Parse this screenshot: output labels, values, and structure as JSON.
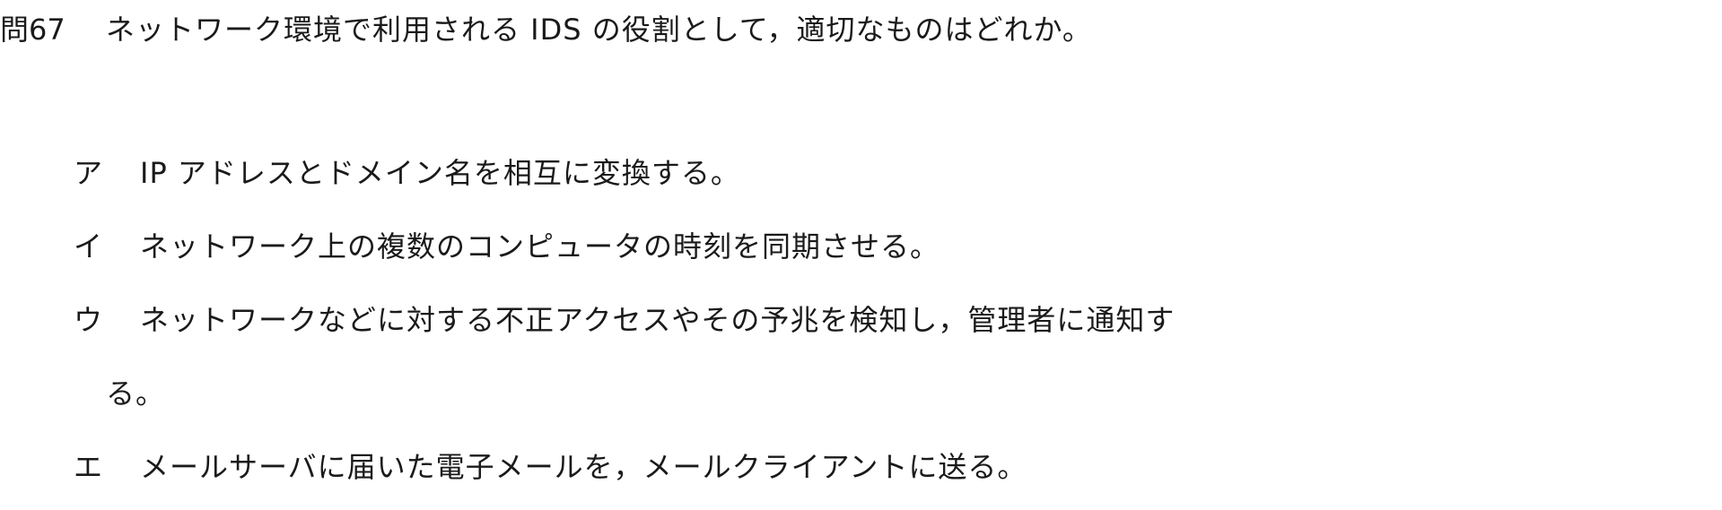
{
  "question": {
    "number": "問67",
    "text": "ネットワーク環境で利用される IDS の役割として，適切なものはどれか。"
  },
  "choices": [
    {
      "label": "ア",
      "text": "IP アドレスとドメイン名を相互に変換する。"
    },
    {
      "label": "イ",
      "text": "ネットワーク上の複数のコンピュータの時刻を同期させる。"
    },
    {
      "label": "ウ",
      "text": "ネットワークなどに対する不正アクセスやその予兆を検知し，管理者に通知す",
      "continuation": "る。"
    },
    {
      "label": "エ",
      "text": "メールサーバに届いた電子メールを，メールクライアントに送る。"
    }
  ]
}
